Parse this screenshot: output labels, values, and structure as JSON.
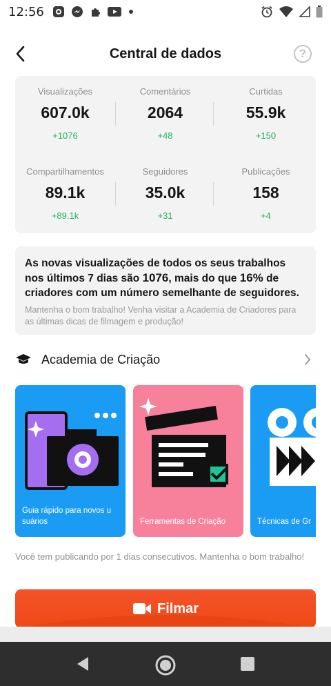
{
  "status_bar": {
    "time": "12:56",
    "left_icons": [
      "dot-icon",
      "messenger-icon",
      "puzzle-icon",
      "youtube-icon",
      "notification-dot-icon"
    ],
    "right_icons": [
      "alarm-icon",
      "wifi-icon",
      "signal-icon",
      "battery-icon"
    ]
  },
  "header": {
    "title": "Central de dados",
    "help_label": "?"
  },
  "stats": [
    {
      "label": "Visualizações",
      "value": "607.0k",
      "delta": "+1076"
    },
    {
      "label": "Comentários",
      "value": "2064",
      "delta": "+48"
    },
    {
      "label": "Curtidas",
      "value": "55.9k",
      "delta": "+150"
    },
    {
      "label": "Compartilhamentos",
      "value": "89.1k",
      "delta": "+89.1k"
    },
    {
      "label": "Seguidores",
      "value": "35.0k",
      "delta": "+31"
    },
    {
      "label": "Publicações",
      "value": "158",
      "delta": "+4"
    }
  ],
  "insight": {
    "part1": "As novas visualizações de todos os seus trabalhos nos últimos 7 dias são ",
    "views": "1076",
    "part2": ", mais do que ",
    "percent": "16%",
    "part3": " de criadores com um número semelhante de seguidores.",
    "sub": "Mantenha o bom trabalho! Venha visitar a Academia de Criadores para as últimas dicas de filmagem e produção!"
  },
  "academy": {
    "title": "Academia de Criação",
    "cards": [
      {
        "label": "Guia rápido para novos u suários",
        "color": "#1a9cf4"
      },
      {
        "label": "Ferramentas de Criação",
        "color": "#f7809a"
      },
      {
        "label": "Técnicas de Gr",
        "color": "#1a9cf4"
      }
    ]
  },
  "footer": {
    "streak_text": "Você tem publicando por 1 dias consecutivos. Mantenha o bom trabalho!",
    "record_label": "Filmar"
  },
  "colors": {
    "accent": "#f04d1c",
    "positive": "#1fb35d",
    "card_bg": "#f3f3f3"
  }
}
